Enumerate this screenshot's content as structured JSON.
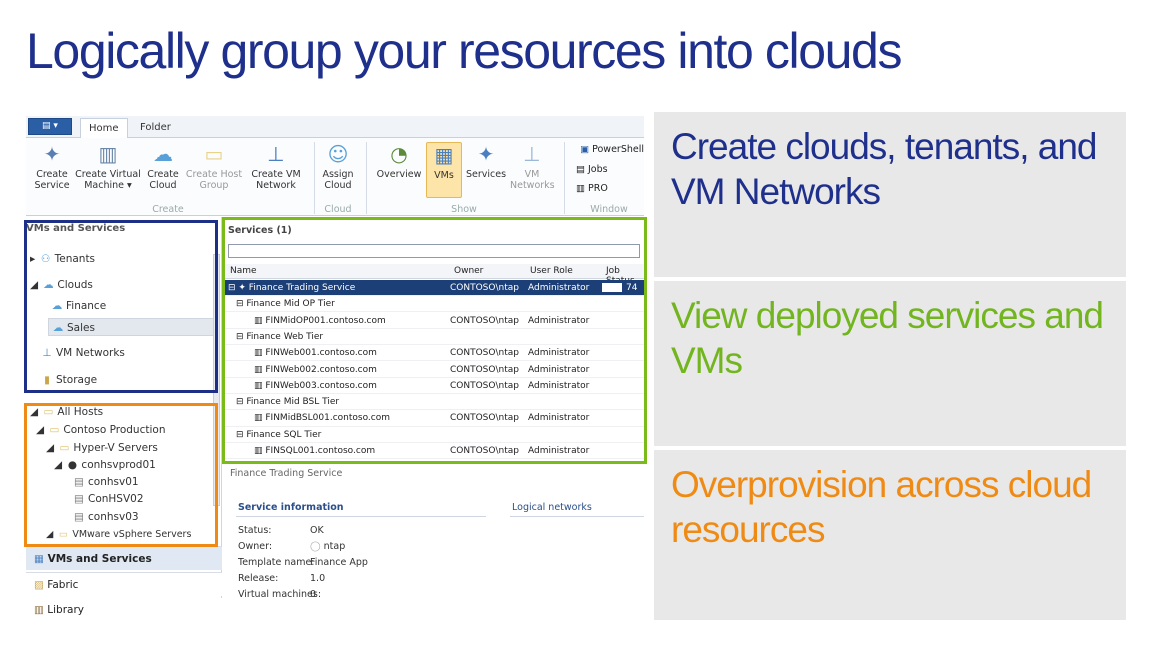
{
  "slide": {
    "title": "Logically group your resources into clouds",
    "panels": [
      {
        "text": "Create clouds, tenants, and VM Networks",
        "color": "#1e2f8c"
      },
      {
        "text": "View deployed services and VMs",
        "color": "#72b51f"
      },
      {
        "text": "Overprovision across cloud resources",
        "color": "#ef8b14"
      }
    ],
    "colors": {
      "blue_box": "#1d2f86",
      "green_box": "#7aba19",
      "orange_box": "#ef8b14"
    }
  },
  "ribbon": {
    "tabs": [
      "Home",
      "Folder"
    ],
    "buttons": {
      "create_service": "Create Service",
      "create_vm": "Create Virtual Machine",
      "create_cloud": "Create Cloud",
      "create_host_group": "Create Host Group",
      "create_vm_network": "Create VM Network",
      "assign_cloud": "Assign Cloud",
      "overview": "Overview",
      "vms": "VMs",
      "services": "Services",
      "vm_networks": "VM Networks",
      "powershell": "PowerShell",
      "jobs": "Jobs",
      "pro": "PRO"
    },
    "groups": {
      "create": "Create",
      "cloud": "Cloud",
      "show": "Show",
      "window": "Window"
    }
  },
  "sidebar": {
    "header": "VMs and Services",
    "tenants": "Tenants",
    "clouds": "Clouds",
    "finance": "Finance",
    "sales": "Sales",
    "vm_networks": "VM Networks",
    "storage": "Storage",
    "all_hosts": "All Hosts",
    "contoso_production": "Contoso Production",
    "hyperv_servers": "Hyper-V Servers",
    "conhsvprod01": "conhsvprod01",
    "conhsv01": "conhsv01",
    "ConHSV02": "ConHSV02",
    "conhsv03": "conhsv03",
    "vmware": "VMware vSphere Servers",
    "bottom_vms": "VMs and Services",
    "fabric": "Fabric",
    "library": "Library"
  },
  "grid": {
    "header": "Services (1)",
    "columns": [
      "Name",
      "Owner",
      "User Role",
      "Job Status"
    ],
    "rows": [
      {
        "name": "Finance Trading Service",
        "owner": "CONTOSO\\ntap",
        "role": "Administrator",
        "job": "74"
      },
      {
        "name": "Finance Mid OP Tier",
        "owner": "",
        "role": "",
        "job": ""
      },
      {
        "name": "FINMidOP001.contoso.com",
        "owner": "CONTOSO\\ntap",
        "role": "Administrator",
        "job": ""
      },
      {
        "name": "Finance Web Tier",
        "owner": "",
        "role": "",
        "job": ""
      },
      {
        "name": "FINWeb001.contoso.com",
        "owner": "CONTOSO\\ntap",
        "role": "Administrator",
        "job": ""
      },
      {
        "name": "FINWeb002.contoso.com",
        "owner": "CONTOSO\\ntap",
        "role": "Administrator",
        "job": ""
      },
      {
        "name": "FINWeb003.contoso.com",
        "owner": "CONTOSO\\ntap",
        "role": "Administrator",
        "job": ""
      },
      {
        "name": "Finance Mid BSL Tier",
        "owner": "",
        "role": "",
        "job": ""
      },
      {
        "name": "FINMidBSL001.contoso.com",
        "owner": "CONTOSO\\ntap",
        "role": "Administrator",
        "job": ""
      },
      {
        "name": "Finance SQL Tier",
        "owner": "",
        "role": "",
        "job": ""
      },
      {
        "name": "FINSQL001.contoso.com",
        "owner": "CONTOSO\\ntap",
        "role": "Administrator",
        "job": ""
      }
    ]
  },
  "details": {
    "title": "Finance Trading Service",
    "service_info": "Service information",
    "logical_networks": "Logical networks",
    "status_label": "Status:",
    "status": "OK",
    "owner_label": "Owner:",
    "owner": "ntap",
    "template_label": "Template name:",
    "template": "Finance App",
    "release_label": "Release:",
    "release": "1.0",
    "vms_label": "Virtual machines:",
    "vms": "0"
  }
}
